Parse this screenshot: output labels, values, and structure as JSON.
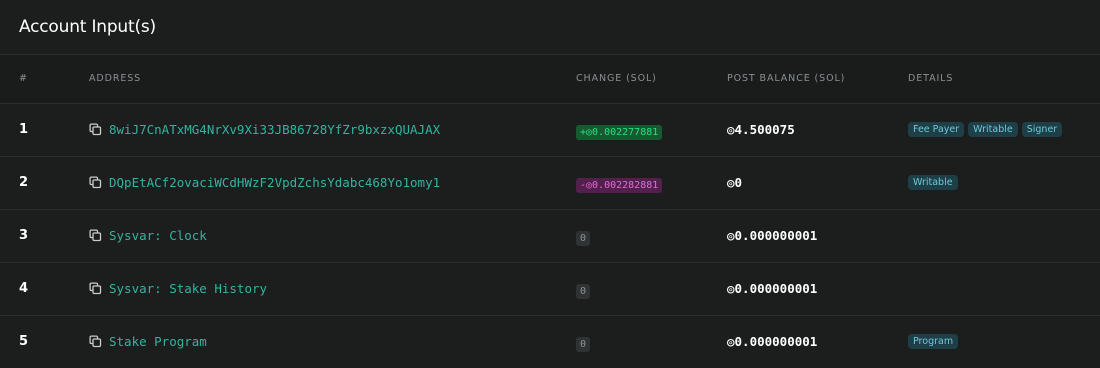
{
  "panel": {
    "title": "Account Input(s)"
  },
  "table": {
    "headers": {
      "index": "#",
      "address": "ADDRESS",
      "change": "CHANGE (SOL)",
      "post_balance": "POST BALANCE (SOL)",
      "details": "DETAILS"
    },
    "rows": [
      {
        "index": "1",
        "address": "8wiJ7CnATxMG4NrXv9Xi33JB86728YfZr9bxzxQUAJAX",
        "change": "+◎0.002277881",
        "change_type": "positive",
        "post_balance": "◎4.500075",
        "tags": [
          "Fee Payer",
          "Writable",
          "Signer"
        ]
      },
      {
        "index": "2",
        "address": "DQpEtACf2ovaciWCdHWzF2VpdZchsYdabc468Yo1omy1",
        "change": "-◎0.002282881",
        "change_type": "negative",
        "post_balance": "◎0",
        "tags": [
          "Writable"
        ]
      },
      {
        "index": "3",
        "address": "Sysvar: Clock",
        "change": "0",
        "change_type": "neutral",
        "post_balance": "◎0.000000001",
        "tags": []
      },
      {
        "index": "4",
        "address": "Sysvar: Stake History",
        "change": "0",
        "change_type": "neutral",
        "post_balance": "◎0.000000001",
        "tags": []
      },
      {
        "index": "5",
        "address": "Stake Program",
        "change": "0",
        "change_type": "neutral",
        "post_balance": "◎0.000000001",
        "tags": [
          "Program"
        ]
      }
    ]
  },
  "icons": {
    "copy": "copy-icon"
  },
  "colors": {
    "background": "#1c1e1e",
    "address_link": "#33b3a0",
    "positive_badge_text": "#26e07f",
    "negative_badge_text": "#e36bd6",
    "tag_text": "#6cc9d9"
  }
}
